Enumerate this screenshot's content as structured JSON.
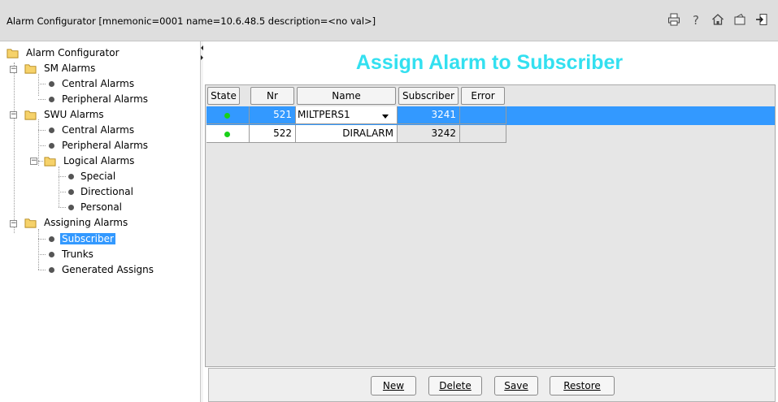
{
  "window": {
    "title": "Alarm Configurator [mnemonic=0001 name=10.6.48.5 description=<no val>]",
    "toolbar_icons": [
      "printer-icon",
      "help-icon",
      "home-icon",
      "export-icon",
      "exit-icon"
    ]
  },
  "tree": {
    "root": "Alarm Configurator",
    "sm_alarms": {
      "label": "SM Alarms",
      "central": "Central Alarms",
      "peripheral": "Peripheral Alarms"
    },
    "swu_alarms": {
      "label": "SWU Alarms",
      "central": "Central Alarms",
      "peripheral": "Peripheral Alarms",
      "logical": {
        "label": "Logical Alarms",
        "special": "Special",
        "directional": "Directional",
        "personal": "Personal"
      }
    },
    "assigning": {
      "label": "Assigning Alarms",
      "subscriber": "Subscriber",
      "trunks": "Trunks",
      "generated": "Generated Assigns"
    }
  },
  "main": {
    "heading": "Assign Alarm to Subscriber",
    "table": {
      "headers": [
        "State",
        "Nr Alarm",
        "Name",
        "Subscriber",
        "Error"
      ],
      "rows": [
        {
          "state_color": "#18d018",
          "nr_alarm": "521",
          "name": "MILTPERS1",
          "subscriber": "3241",
          "error": ""
        },
        {
          "state_color": "#18d018",
          "nr_alarm": "522",
          "name": "DIRALARM",
          "subscriber": "3242",
          "error": ""
        }
      ]
    }
  },
  "buttons": {
    "new": "New",
    "delete": "Delete",
    "save": "Save",
    "restore": "Restore"
  },
  "colors": {
    "heading": "#33e0f0",
    "selection": "#3399ff",
    "state_ok": "#18d018"
  }
}
